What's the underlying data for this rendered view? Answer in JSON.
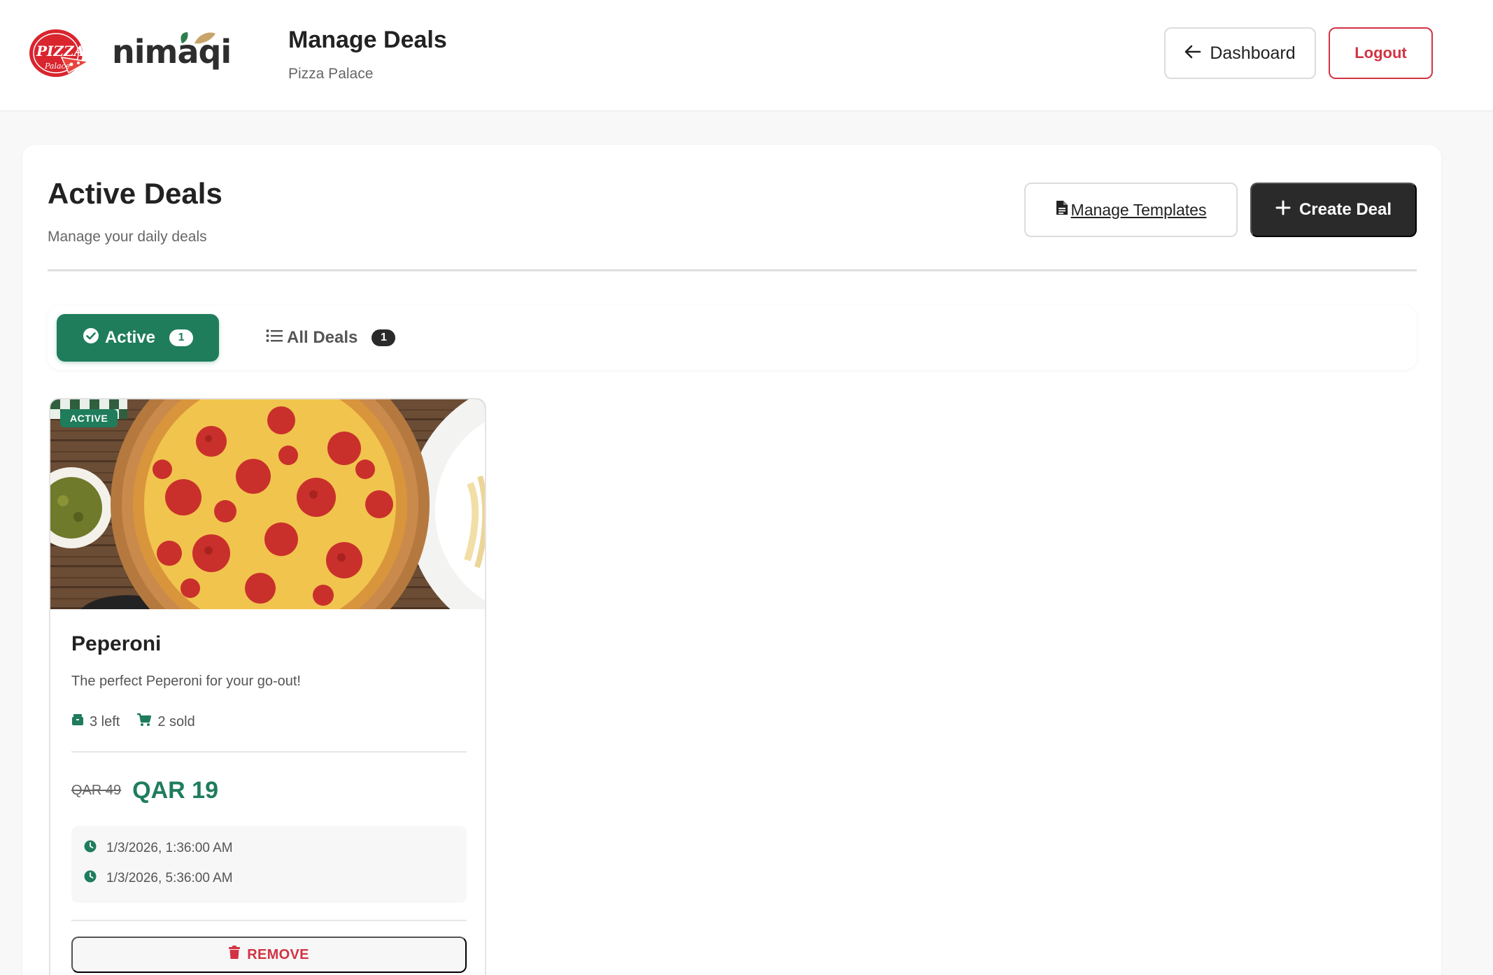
{
  "header": {
    "badge_text": "PIZZA",
    "badge_subtext": "Palace",
    "logo_text": "nimaqi",
    "title": "Manage Deals",
    "subtitle": "Pizza Palace",
    "dashboard_label": "Dashboard",
    "logout_label": "Logout"
  },
  "main": {
    "title": "Active Deals",
    "subtitle": "Manage your daily deals",
    "manage_templates_label": "Manage Templates",
    "create_deal_label": "Create Deal",
    "tabs": [
      {
        "label": "Active",
        "count": "1",
        "selected": true
      },
      {
        "label": "All Deals",
        "count": "1",
        "selected": false
      }
    ]
  },
  "deal": {
    "status": "ACTIVE",
    "name": "Peperoni",
    "description": "The perfect Peperoni for your go-out!",
    "left": "3 left",
    "sold": "2 sold",
    "old_price": "QAR 49",
    "new_price": "QAR 19",
    "start_time": "1/3/2026, 1:36:00 AM",
    "end_time": "1/3/2026, 5:36:00 AM",
    "remove_label": "REMOVE"
  },
  "colors": {
    "accent_green": "#1f7d5c",
    "danger_red": "#d23344",
    "dark_button": "#2a2a2a"
  },
  "icons": [
    "arrow-left-icon",
    "document-icon",
    "plus-icon",
    "check-circle-icon",
    "list-icon",
    "box-icon",
    "cart-icon",
    "clock-icon",
    "trash-icon"
  ]
}
